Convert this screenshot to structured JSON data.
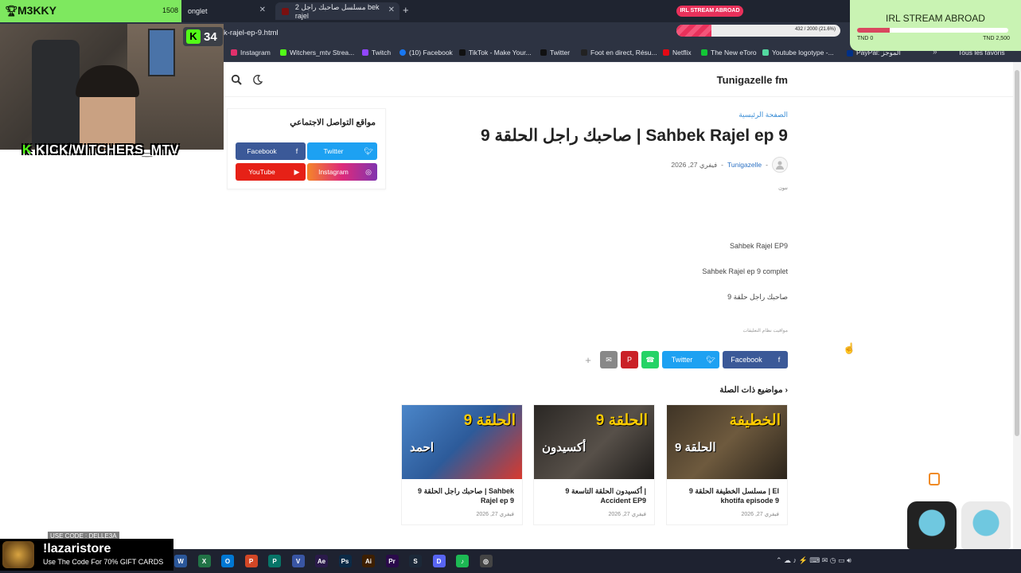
{
  "overlay": {
    "top_name": "M3KKY",
    "top_count": "1508",
    "kick_count": "34",
    "kick_handle": "KICK/WITCHERS_MTV",
    "irl_badge": "IRL STREAM ABROAD",
    "irl_bar_text": "432 / 2000 (21.6%)",
    "irl_bar_progress": 0.216,
    "irl_card_title": "IRL STREAM ABROAD",
    "irl_card_low": "TND 0",
    "irl_card_high": "TND 2,500",
    "irl_card_progress": 0.216,
    "promo_code": "USE CODE : DELLE3A",
    "promo_title": "!lazaristore",
    "promo_sub": "Use The Code For 70% GIFT CARDS"
  },
  "browser": {
    "tabs": [
      {
        "label": "onglet"
      },
      {
        "label": "مسلسل صاحبك راجل 2 bek rajel"
      }
    ],
    "new_tab": "+",
    "url": "k-rajel-ep-9.html",
    "bookmarks": [
      {
        "label": "Instagram",
        "color": "#e1306c"
      },
      {
        "label": "Witchers_mtv Strea...",
        "color": "#53fc18"
      },
      {
        "label": "Twitch",
        "color": "#9146ff"
      },
      {
        "label": "(10) Facebook",
        "color": "#1877f2"
      },
      {
        "label": "TikTok - Make Your...",
        "color": "#111111"
      },
      {
        "label": "Twitter",
        "color": "#111111"
      },
      {
        "label": "Foot en direct, Résu...",
        "color": "#222222"
      },
      {
        "label": "Netflix",
        "color": "#e50914"
      },
      {
        "label": "The New eToro",
        "color": "#13c636"
      },
      {
        "label": "Youtube logotype -...",
        "color": "#53d9a0"
      },
      {
        "label": "PayPal: الموجز",
        "color": "#003087"
      }
    ],
    "bookmarks_more": "»",
    "bookmarks_folder": "Tous les favoris"
  },
  "site": {
    "title": "Tunigazelle fm",
    "social": {
      "heading": "مواقع التواصل الاجتماعي",
      "facebook": "Facebook",
      "twitter": "Twitter",
      "youtube": "YouTube",
      "instagram": "Instagram"
    },
    "breadcrumb": "الصفحة الرئيسية",
    "post_title": "صاحبك راجل الحلقة 9 | Sahbek Rajel ep 9",
    "author": "Tunigazelle",
    "date": "فيفري 27, 2026",
    "label": "ننون",
    "lines": [
      "Sahbek Rajel EP9",
      "Sahbek Rajel ep 9 complet",
      "صاحبك راجل حلقة 9"
    ],
    "note": "مواقيت نظام التعليقات",
    "share": {
      "plus": "+",
      "twitter": "Twitter",
      "facebook": "Facebook"
    },
    "related_heading": "مواضيع ذات الصلة ›",
    "related": [
      {
        "cap": "الحلقة 9",
        "cap2": "احمد",
        "title": "صاحبك راجل الحلقة 9 | Sahbek Rajel ep 9",
        "date": "فيفري 27, 2026"
      },
      {
        "cap": "الحلقة 9",
        "cap2": "أكسيدون",
        "title": "أكسيدون الحلقة التاسعة 9 | Accident EP9",
        "date": "فيفري 27, 2026"
      },
      {
        "cap": "الخطيفة",
        "cap2": "الحلقة 9",
        "title": "مسلسل الخطيفة الحلقة 9 | El khotifa episode 9",
        "date": "فيفري 27, 2026"
      }
    ]
  },
  "taskbar": {
    "apps": [
      {
        "name": "word",
        "glyph": "W",
        "color": "#2b579a"
      },
      {
        "name": "excel",
        "glyph": "X",
        "color": "#217346"
      },
      {
        "name": "outlook",
        "glyph": "O",
        "color": "#0078d4"
      },
      {
        "name": "powerpoint",
        "glyph": "P",
        "color": "#d24726"
      },
      {
        "name": "publisher",
        "glyph": "P",
        "color": "#077568"
      },
      {
        "name": "visio",
        "glyph": "V",
        "color": "#3955a3"
      },
      {
        "name": "aftereffects",
        "glyph": "Ae",
        "color": "#2a1a4a"
      },
      {
        "name": "photoshop",
        "glyph": "Ps",
        "color": "#0b2a46"
      },
      {
        "name": "illustrator",
        "glyph": "Ai",
        "color": "#3d1f00"
      },
      {
        "name": "premiere",
        "glyph": "Pr",
        "color": "#2a0a4a"
      },
      {
        "name": "steam",
        "glyph": "S",
        "color": "#1b2838"
      },
      {
        "name": "discord",
        "glyph": "D",
        "color": "#5865f2"
      },
      {
        "name": "spotify",
        "glyph": "♪",
        "color": "#1db954"
      },
      {
        "name": "chrome",
        "glyph": "◎",
        "color": "#444444"
      }
    ]
  }
}
